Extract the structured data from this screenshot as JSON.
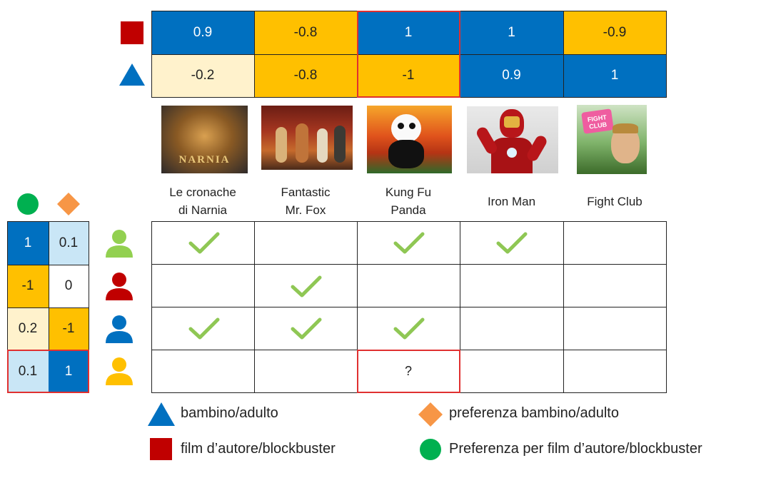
{
  "item_features": {
    "rows": [
      {
        "shape": "red-square-icon",
        "values": [
          "0.9",
          "-0.8",
          "1",
          "1",
          "-0.9"
        ]
      },
      {
        "shape": "blue-triangle-icon",
        "values": [
          "-0.2",
          "-0.8",
          "-1",
          "0.9",
          "1"
        ]
      }
    ]
  },
  "movies": [
    {
      "title": "Le cronache\ndi Narnia",
      "poster_text": "NARNIA"
    },
    {
      "title": "Fantastic\nMr. Fox"
    },
    {
      "title": "Kung Fu\nPanda"
    },
    {
      "title": "Iron Man"
    },
    {
      "title": "Fight Club",
      "poster_text": "FIGHT CLUB"
    }
  ],
  "user_features": {
    "header_icons": [
      "green-circle-icon",
      "orange-diamond-icon"
    ],
    "rows": [
      {
        "values": [
          "1",
          "0.1"
        ]
      },
      {
        "values": [
          "-1",
          "0"
        ]
      },
      {
        "values": [
          "0.2",
          "-1"
        ]
      },
      {
        "values": [
          "0.1",
          "1"
        ]
      }
    ]
  },
  "users": [
    {
      "icon": "user-green-icon",
      "color": "#92d050"
    },
    {
      "icon": "user-red-icon",
      "color": "#c00000"
    },
    {
      "icon": "user-blue-icon",
      "color": "#0070c0"
    },
    {
      "icon": "user-yellow-icon",
      "color": "#ffc000"
    }
  ],
  "ratings": [
    [
      "check",
      "",
      "check",
      "check",
      ""
    ],
    [
      "",
      "check",
      "",
      "",
      ""
    ],
    [
      "check",
      "check",
      "check",
      "",
      ""
    ],
    [
      "",
      "",
      "?",
      "",
      ""
    ]
  ],
  "legend": {
    "triangle": "bambino/adulto",
    "diamond": "preferenza bambino/adulto",
    "square": "film d’autore/blockbuster",
    "circle": "Preferenza per film d’autore/blockbuster"
  },
  "colors": {
    "blue": "#0070c0",
    "yellow": "#ffc000",
    "cream": "#fff2cc",
    "light_blue": "#c9e6f6",
    "red": "#c00000",
    "green": "#00b050",
    "orange": "#f79646",
    "check_green": "#8fc754",
    "highlight_red": "#e03030"
  }
}
